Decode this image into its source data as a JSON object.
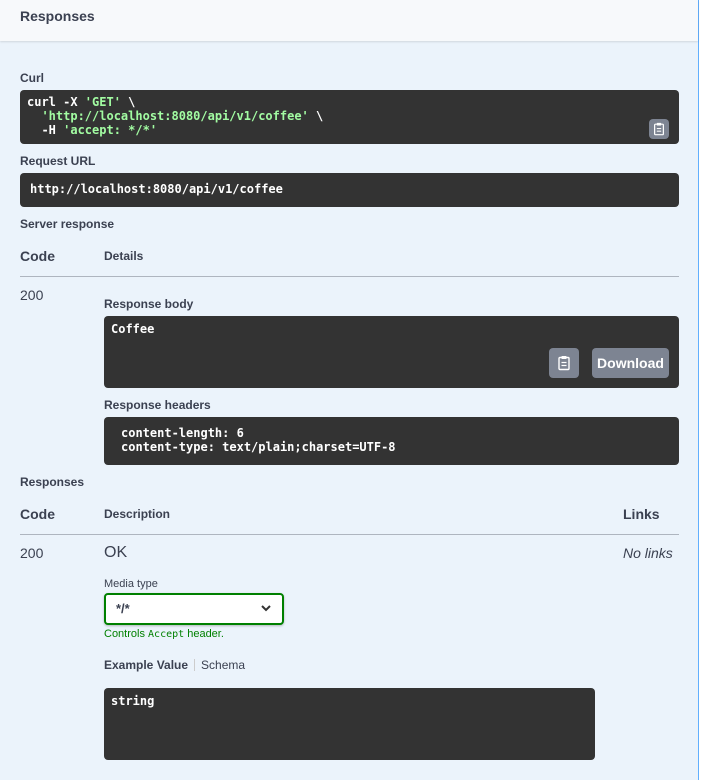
{
  "section": {
    "title": "Responses"
  },
  "curl": {
    "label": "Curl",
    "line1_cmd": "curl -X ",
    "line1_method": "'GET'",
    "line1_tail": " \\",
    "line2_indent": "  ",
    "line2_url": "'http://localhost:8080/api/v1/coffee'",
    "line2_tail": " \\",
    "line3_cmd": "  -H ",
    "line3_header": "'accept: */*'"
  },
  "request_url": {
    "label": "Request URL",
    "value": "http://localhost:8080/api/v1/coffee"
  },
  "server_response": {
    "label": "Server response",
    "col_code": "Code",
    "col_details": "Details",
    "code": "200",
    "body_label": "Response body",
    "body": "Coffee",
    "download_label": "Download",
    "headers_label": "Response headers",
    "header_line1": "content-length: 6",
    "header_line2": "content-type: text/plain;charset=UTF-8"
  },
  "responses": {
    "label": "Responses",
    "col_code": "Code",
    "col_description": "Description",
    "col_links": "Links",
    "code": "200",
    "description": "OK",
    "links": "No links",
    "media_type_label": "Media type",
    "media_type_value": "*/*",
    "controls_prefix": "Controls ",
    "controls_code": "Accept",
    "controls_suffix": " header.",
    "tab_example": "Example Value",
    "tab_schema": "Schema",
    "example": "string"
  },
  "colors": {
    "accent": "#61affe",
    "panel_bg": "#ebf3fb",
    "code_bg": "#333333",
    "string": "#a2fca2",
    "select_border": "#008000"
  },
  "icons": [
    "clipboard-icon",
    "chevron-down-icon"
  ]
}
